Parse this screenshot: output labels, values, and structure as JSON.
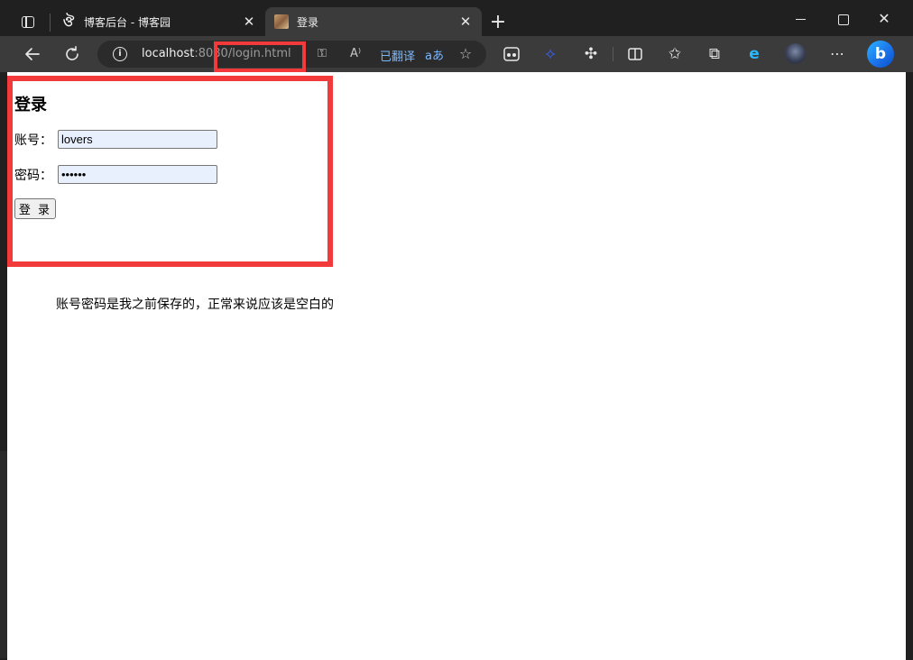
{
  "browser": {
    "tabs": [
      {
        "title": "博客后台 - 博客园",
        "active": false,
        "favicon": "cnblogs-icon"
      },
      {
        "title": "登录",
        "active": true,
        "favicon": "page-thumbnail-icon"
      }
    ],
    "new_tab_label": "+",
    "address": {
      "host": "localhost",
      "rest": ":8080/login.html",
      "translate_label": "已翻译",
      "translate_aa": "aあ"
    },
    "window_controls": {
      "close": "✕"
    }
  },
  "page": {
    "heading": "登录",
    "form": {
      "account_label": "账号：",
      "account_value": "lovers",
      "password_label": "密码：",
      "password_value": "......",
      "submit_label": "登 录"
    },
    "note": "账号密码是我之前保存的，正常来说应该是空白的"
  },
  "colors": {
    "highlight": "#f23a3a",
    "autofill_bg": "#e8f0fe",
    "chrome_dark": "#202020",
    "toolbar": "#3b3b3b"
  }
}
